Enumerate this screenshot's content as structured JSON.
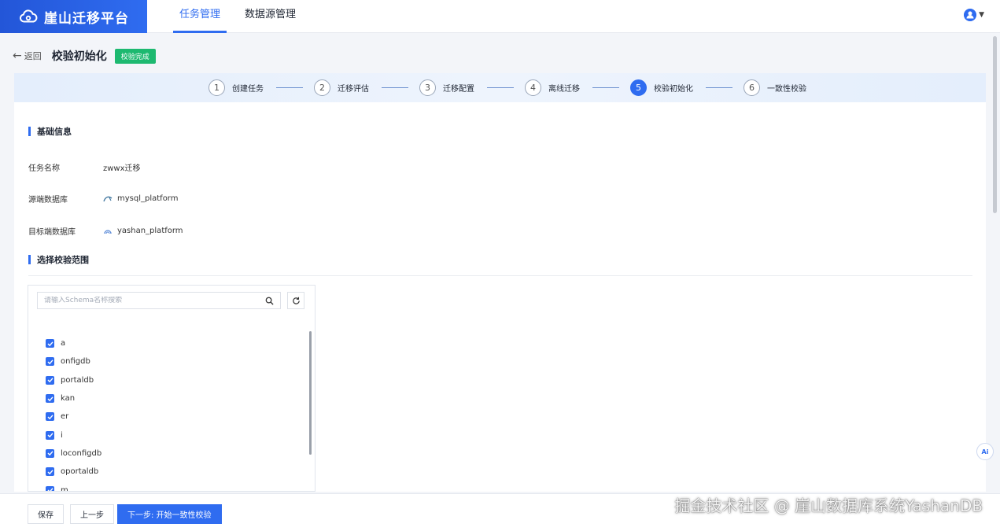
{
  "app": {
    "title": "崖山迁移平台"
  },
  "nav": [
    {
      "label": "任务管理",
      "active": true
    },
    {
      "label": "数据源管理",
      "active": false
    }
  ],
  "header": {
    "back_label": "返回",
    "title": "校验初始化",
    "status": "校验完成"
  },
  "steps": [
    {
      "num": "1",
      "label": "创建任务"
    },
    {
      "num": "2",
      "label": "迁移评估"
    },
    {
      "num": "3",
      "label": "迁移配置"
    },
    {
      "num": "4",
      "label": "离线迁移"
    },
    {
      "num": "5",
      "label": "校验初始化"
    },
    {
      "num": "6",
      "label": "一致性校验"
    }
  ],
  "basic_info": {
    "title": "基础信息",
    "task_name_label": "任务名称",
    "task_name_value": "zwwx迁移",
    "source_db_label": "源端数据库",
    "source_db_value": "mysql_platform",
    "target_db_label": "目标端数据库",
    "target_db_value": "yashan_platform"
  },
  "scope": {
    "title": "选择校验范围",
    "search_placeholder": "请输入Schema名称搜索",
    "schemas": [
      "a",
      "onfigdb",
      "portaldb",
      "kan",
      "er",
      "i",
      "loconfigdb",
      "oportaldb",
      "m"
    ]
  },
  "footer": {
    "save_label": "保存",
    "prev_label": "上一步",
    "next_label": "下一步: 开始一致性校验"
  },
  "watermark": "掘金技术社区 @ 崖山数据库系统YashanDB",
  "colors": {
    "primary": "#2f6cf0",
    "success": "#1db970"
  }
}
